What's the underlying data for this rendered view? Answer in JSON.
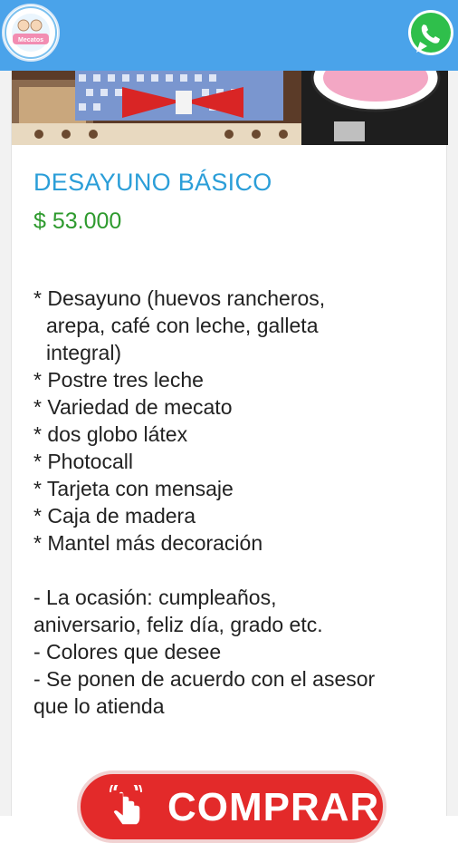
{
  "header": {
    "logo_text": "Mecatos",
    "whatsapp_icon": "whatsapp-icon",
    "bar_color": "#4aa3ea"
  },
  "product": {
    "title": "DESAYUNO BÁSICO",
    "price": "$ 53.000",
    "description": [
      "* Desayuno (huevos rancheros,",
      "arepa, café con leche, galleta",
      "integral)",
      "* Postre tres leche",
      "* Variedad de mecato",
      "* dos globo látex",
      "* Photocall",
      "* Tarjeta con mensaje",
      "* Caja de madera",
      "* Mantel más decoración",
      "- La ocasión: cumpleaños,",
      "aniversario, feliz día, grado etc.",
      "- Colores que desee",
      "- Se ponen de acuerdo con el asesor",
      "que lo atienda"
    ]
  },
  "actions": {
    "buy_label": "COMPRAR",
    "buy_color": "#e32a2a"
  }
}
